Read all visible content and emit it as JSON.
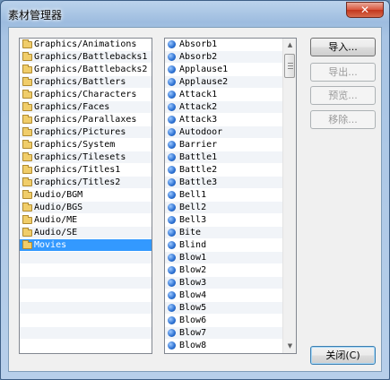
{
  "window": {
    "title": "素材管理器",
    "close_glyph": "✕"
  },
  "folders": {
    "selected_index": 16,
    "items": [
      "Graphics/Animations",
      "Graphics/Battlebacks1",
      "Graphics/Battlebacks2",
      "Graphics/Battlers",
      "Graphics/Characters",
      "Graphics/Faces",
      "Graphics/Parallaxes",
      "Graphics/Pictures",
      "Graphics/System",
      "Graphics/Tilesets",
      "Graphics/Titles1",
      "Graphics/Titles2",
      "Audio/BGM",
      "Audio/BGS",
      "Audio/ME",
      "Audio/SE",
      "Movies"
    ],
    "icon": "folder-icon"
  },
  "files": {
    "items": [
      "Absorb1",
      "Absorb2",
      "Applause1",
      "Applause2",
      "Attack1",
      "Attack2",
      "Attack3",
      "Autodoor",
      "Barrier",
      "Battle1",
      "Battle2",
      "Battle3",
      "Bell1",
      "Bell2",
      "Bell3",
      "Bite",
      "Blind",
      "Blow1",
      "Blow2",
      "Blow3",
      "Blow4",
      "Blow5",
      "Blow6",
      "Blow7",
      "Blow8"
    ],
    "icon": "audio-file-icon"
  },
  "buttons": {
    "import": "导入...",
    "export": "导出...",
    "preview": "预览...",
    "remove": "移除...",
    "close": "关闭(C)"
  }
}
